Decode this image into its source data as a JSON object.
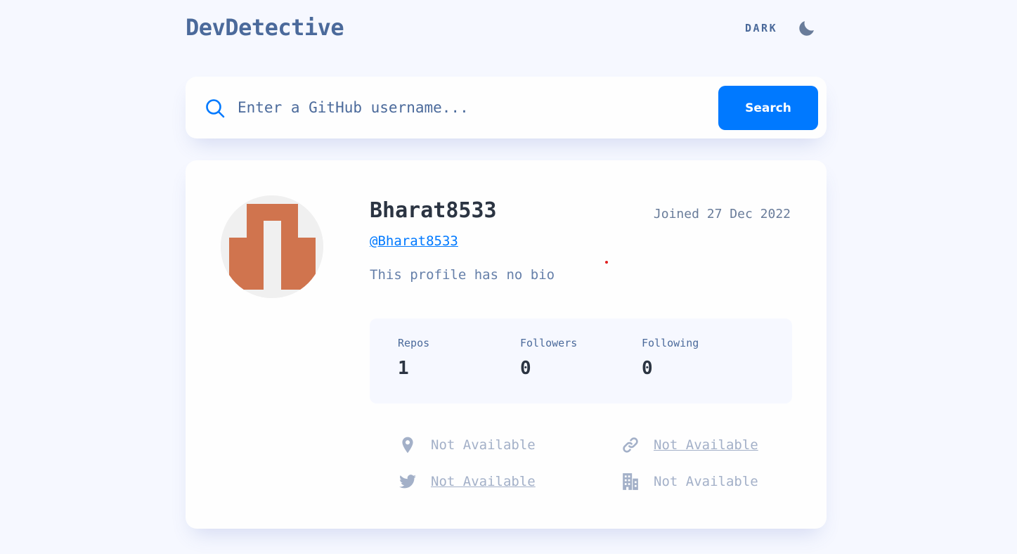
{
  "header": {
    "logo": "DevDetective",
    "theme_label": "DARK",
    "theme_icon": "moon-icon"
  },
  "search": {
    "placeholder": "Enter a GitHub username...",
    "button_label": "Search",
    "icon": "search-icon"
  },
  "profile": {
    "name": "Bharat8533",
    "joined": "Joined 27 Dec 2022",
    "handle": "@Bharat8533",
    "bio": "This profile has no bio",
    "avatar_colors": {
      "background": "#f0f0f0",
      "pattern": "#d0744e"
    },
    "stats": [
      {
        "label": "Repos",
        "value": "1"
      },
      {
        "label": "Followers",
        "value": "0"
      },
      {
        "label": "Following",
        "value": "0"
      }
    ],
    "links": {
      "location": {
        "icon": "location-pin-icon",
        "text": "Not Available"
      },
      "blog": {
        "icon": "link-icon",
        "text": "Not Available"
      },
      "twitter": {
        "icon": "twitter-icon",
        "text": "Not Available"
      },
      "company": {
        "icon": "building-icon",
        "text": "Not Available"
      }
    }
  },
  "colors": {
    "page_bg": "#f6f8ff",
    "card_bg": "#fefefe",
    "accent": "#0079ff",
    "heading": "#2b3442",
    "text": "#4b6a9b",
    "muted": "#a3b0c8"
  }
}
